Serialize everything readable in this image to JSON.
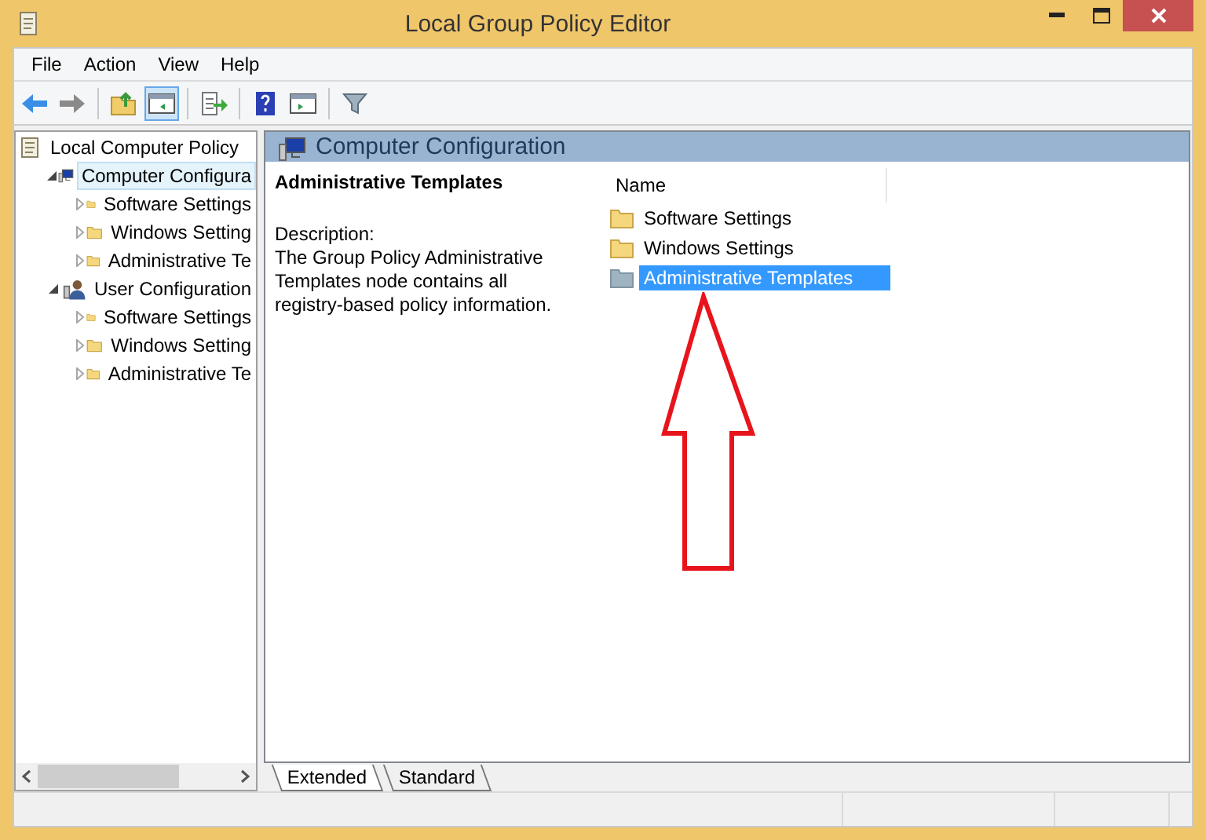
{
  "window": {
    "title": "Local Group Policy Editor"
  },
  "menu": [
    "File",
    "Action",
    "View",
    "Help"
  ],
  "toolbar": [
    {
      "kind": "back",
      "pressed": false
    },
    {
      "kind": "forward",
      "pressed": false
    },
    {
      "kind": "sep"
    },
    {
      "kind": "up",
      "pressed": false
    },
    {
      "kind": "tree",
      "pressed": true
    },
    {
      "kind": "sep"
    },
    {
      "kind": "export",
      "pressed": false
    },
    {
      "kind": "sep"
    },
    {
      "kind": "help",
      "pressed": false
    },
    {
      "kind": "panel",
      "pressed": false
    },
    {
      "kind": "sep"
    },
    {
      "kind": "filter",
      "pressed": false
    }
  ],
  "tree": [
    {
      "label": "Local Computer Policy",
      "kind": "policy",
      "selected": false,
      "children": [
        {
          "label": "Computer Configura",
          "kind": "computer",
          "expanded": true,
          "selected": true,
          "children": [
            {
              "label": "Software Settings",
              "kind": "folder",
              "expanded": false,
              "selected": false
            },
            {
              "label": "Windows Setting",
              "kind": "folder",
              "expanded": false,
              "selected": false
            },
            {
              "label": "Administrative Te",
              "kind": "folder",
              "expanded": false,
              "selected": false
            }
          ]
        },
        {
          "label": "User Configuration",
          "kind": "user",
          "expanded": true,
          "selected": false,
          "children": [
            {
              "label": "Software Settings",
              "kind": "folder",
              "expanded": false,
              "selected": false
            },
            {
              "label": "Windows Setting",
              "kind": "folder",
              "expanded": false,
              "selected": false
            },
            {
              "label": "Administrative Te",
              "kind": "folder",
              "expanded": false,
              "selected": false
            }
          ]
        }
      ]
    }
  ],
  "pane": {
    "title": "Computer Configuration",
    "detail_title": "Administrative Templates",
    "description_label": "Description:",
    "description": "The Group Policy Administrative Templates node contains all registry-based policy information.",
    "column": "Name",
    "items": [
      {
        "label": "Software Settings",
        "selected": false
      },
      {
        "label": "Windows Settings",
        "selected": false
      },
      {
        "label": "Administrative Templates",
        "selected": true
      }
    ]
  },
  "tabs": [
    {
      "label": "Extended",
      "selected": true
    },
    {
      "label": "Standard",
      "selected": false
    }
  ]
}
